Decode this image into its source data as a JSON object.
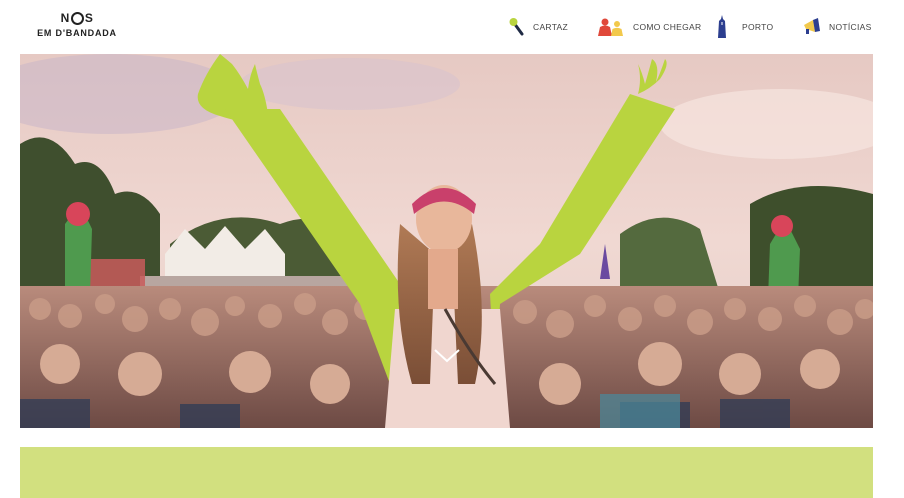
{
  "brand": {
    "top": "N",
    "top_end": "S",
    "bottom": "EM D'BANDADA"
  },
  "nav": [
    {
      "label": "CARTAZ",
      "icon": "microphone-icon"
    },
    {
      "label": "COMO CHEGAR",
      "icon": "people-icon"
    },
    {
      "label": "PORTO",
      "icon": "tower-icon"
    },
    {
      "label": "NOTÍCIAS",
      "icon": "megaphone-icon"
    }
  ],
  "hero": {
    "image": "festival-crowd-photo",
    "scroll_icon": "chevron-down-icon"
  },
  "colors": {
    "accent_green": "#b9d43f",
    "band_green": "#d2e07f",
    "text": "#444444"
  }
}
